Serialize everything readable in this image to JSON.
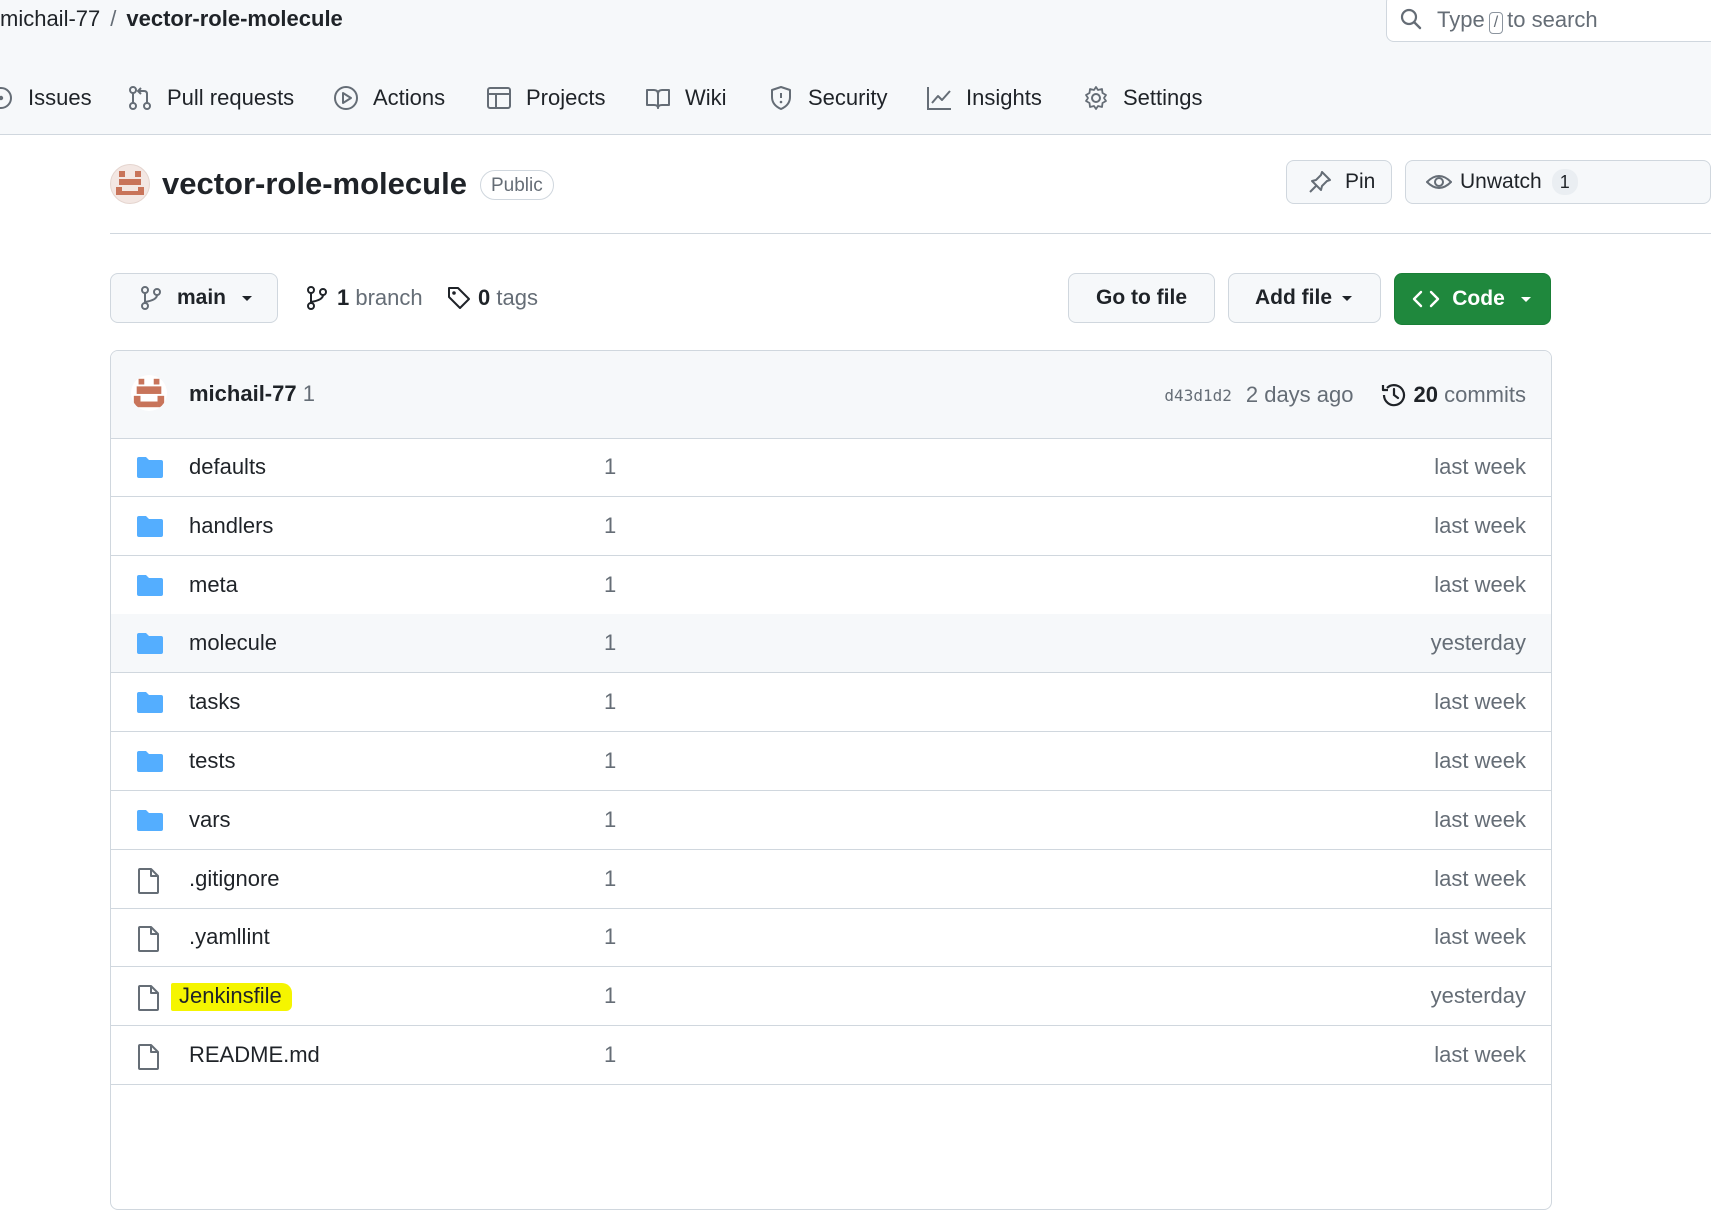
{
  "header": {
    "owner": "michail-77",
    "separator": "/",
    "repo": "vector-role-molecule",
    "search": {
      "prefix": "Type",
      "key": "/",
      "suffix": "to search"
    }
  },
  "nav_tabs": [
    {
      "label": "Issues",
      "icon": "issue-opened-icon"
    },
    {
      "label": "Pull requests",
      "icon": "git-pull-request-icon"
    },
    {
      "label": "Actions",
      "icon": "play-icon"
    },
    {
      "label": "Projects",
      "icon": "table-icon"
    },
    {
      "label": "Wiki",
      "icon": "book-icon"
    },
    {
      "label": "Security",
      "icon": "shield-icon"
    },
    {
      "label": "Insights",
      "icon": "graph-icon"
    },
    {
      "label": "Settings",
      "icon": "gear-icon"
    }
  ],
  "repo_header": {
    "name": "vector-role-molecule",
    "visibility": "Public",
    "pin_label": "Pin",
    "unwatch_label": "Unwatch",
    "watch_count": "1"
  },
  "toolbar": {
    "branch_name": "main",
    "branch_count": "1",
    "branch_label": "branch",
    "tag_count": "0",
    "tag_label": "tags",
    "go_to_file": "Go to file",
    "add_file": "Add file",
    "code": "Code"
  },
  "last_commit": {
    "author": "michail-77",
    "message": "1",
    "sha": "d43d1d2",
    "age": "2 days ago",
    "commit_count": "20",
    "commit_label": "commits"
  },
  "files": [
    {
      "name": "defaults",
      "type": "dir",
      "message": "1",
      "age": "last week"
    },
    {
      "name": "handlers",
      "type": "dir",
      "message": "1",
      "age": "last week"
    },
    {
      "name": "meta",
      "type": "dir",
      "message": "1",
      "age": "last week"
    },
    {
      "name": "molecule",
      "type": "dir",
      "message": "1",
      "age": "yesterday"
    },
    {
      "name": "tasks",
      "type": "dir",
      "message": "1",
      "age": "last week"
    },
    {
      "name": "tests",
      "type": "dir",
      "message": "1",
      "age": "last week"
    },
    {
      "name": "vars",
      "type": "dir",
      "message": "1",
      "age": "last week"
    },
    {
      "name": ".gitignore",
      "type": "file",
      "message": "1",
      "age": "last week"
    },
    {
      "name": ".yamllint",
      "type": "file",
      "message": "1",
      "age": "last week"
    },
    {
      "name": "Jenkinsfile",
      "type": "file",
      "message": "1",
      "age": "yesterday"
    },
    {
      "name": "README.md",
      "type": "file",
      "message": "1",
      "age": "last week"
    }
  ],
  "colors": {
    "code_button": "#1f883d",
    "folder": "#54aeff",
    "highlight": "#f5f500"
  }
}
